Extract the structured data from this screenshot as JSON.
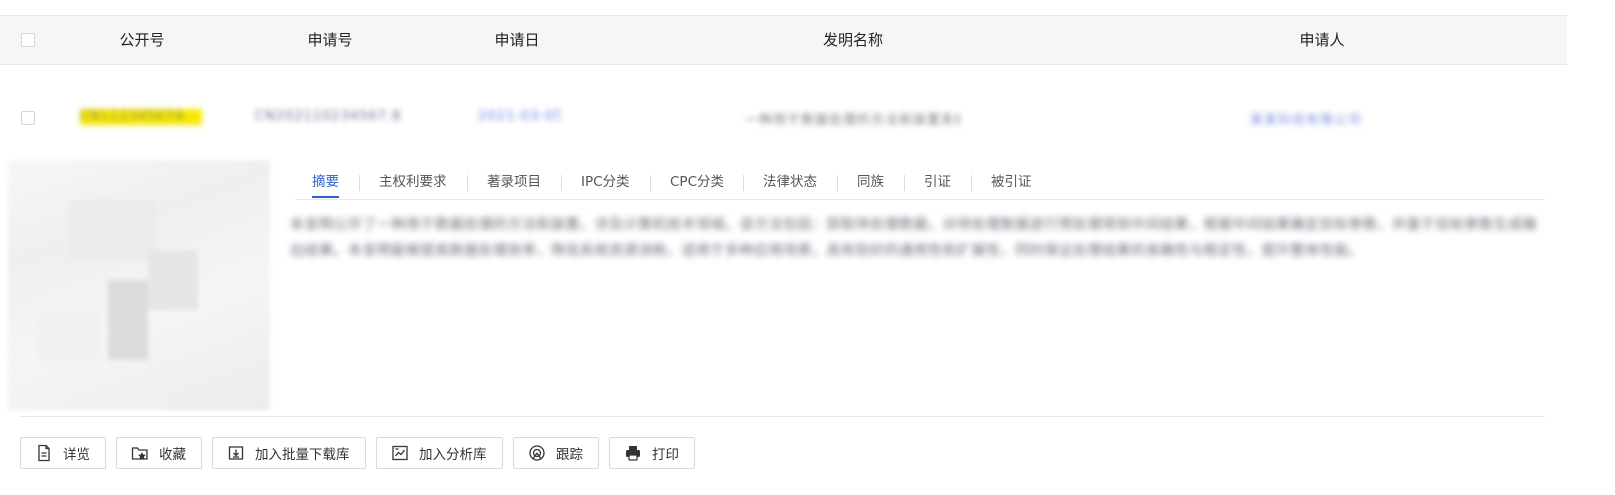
{
  "table": {
    "headers": {
      "pub_no": "公开号",
      "app_no": "申请号",
      "app_date": "申请日",
      "title": "发明名称",
      "applicant": "申请人"
    },
    "row": {
      "pub_no": "CN11234567A",
      "app_no": "CN202110234567.8",
      "app_date": "2021-03-05",
      "title": "一种用于数据处理的方法和装置系统",
      "applicant": "某某科技有限公司"
    }
  },
  "tabs": [
    {
      "label": "摘要",
      "active": true
    },
    {
      "label": "主权利要求",
      "active": false
    },
    {
      "label": "著录项目",
      "active": false
    },
    {
      "label": "IPC分类",
      "active": false
    },
    {
      "label": "CPC分类",
      "active": false
    },
    {
      "label": "法律状态",
      "active": false
    },
    {
      "label": "同族",
      "active": false
    },
    {
      "label": "引证",
      "active": false
    },
    {
      "label": "被引证",
      "active": false
    }
  ],
  "abstract_text": "本发明公开了一种用于数据处理的方法和装置，涉及计算机技术领域。该方法包括：获取待处理数据，对待处理数据进行预处理得到中间结果，根据中间结果确定目标参数，并基于目标参数生成输出结果。本发明能够提高数据处理效率，降低系统资源消耗，适用于多种应用场景，具有较好的通用性和扩展性，同时保证处理结果的准确性与稳定性，提升整体性能。",
  "actions": {
    "detail": "详览",
    "favorite": "收藏",
    "batch_download": "加入批量下载库",
    "analysis": "加入分析库",
    "track": "跟踪",
    "print": "打印"
  },
  "colors": {
    "accent": "#2f62c8",
    "highlight": "#f7ea00",
    "link": "#5f7ee6"
  }
}
